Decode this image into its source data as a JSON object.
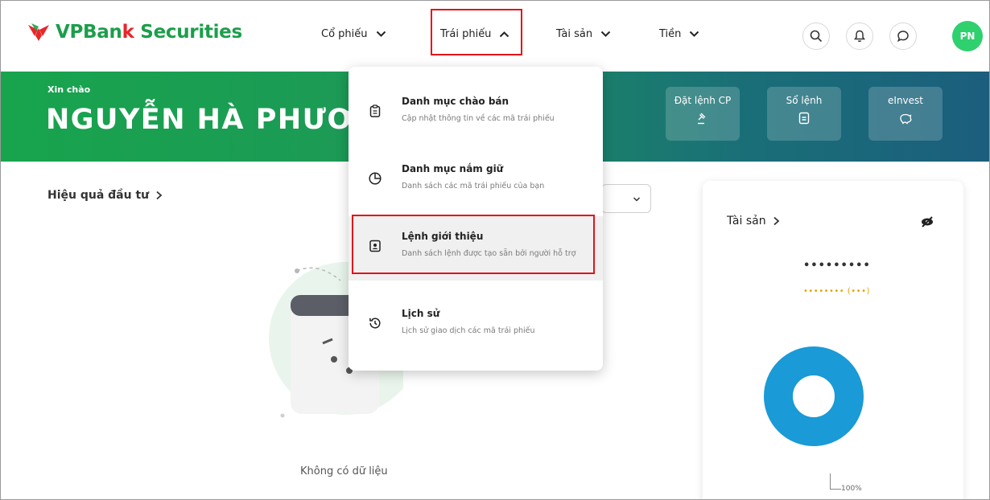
{
  "brand": {
    "name_part1": "VPBan",
    "name_accent": "k",
    "name_part2": " Securities"
  },
  "nav": {
    "items": [
      {
        "label": "Cổ phiếu"
      },
      {
        "label": "Trái phiếu"
      },
      {
        "label": "Tài sản"
      },
      {
        "label": "Tiền"
      }
    ]
  },
  "header_icons": [
    "search-icon",
    "bell-icon",
    "chat-icon"
  ],
  "avatar": {
    "initials": "PN"
  },
  "banner": {
    "greeting": "Xin chào",
    "username": "NGUYỄN HÀ PHƯƠN",
    "quick_actions": [
      {
        "label": "Đặt lệnh CP",
        "icon": "gavel-icon"
      },
      {
        "label": "Sổ lệnh",
        "icon": "document-icon"
      },
      {
        "label": "eInvest",
        "icon": "piggy-bank-icon"
      }
    ]
  },
  "performance": {
    "title": "Hiệu quả đầu tư",
    "empty_text": "Không có dữ liệu"
  },
  "assets": {
    "title": "Tài sản",
    "masked_value": "•••••••••",
    "masked_change": "•••••••• (•••)",
    "pie_label": "100%"
  },
  "dropdown": {
    "items": [
      {
        "title": "Danh mục chào bán",
        "desc": "Cập nhật thông tin về các mã trái phiếu",
        "icon": "clipboard-icon"
      },
      {
        "title": "Danh mục nắm giữ",
        "desc": "Danh sách các mã trái phiếu của bạn",
        "icon": "pie-chart-icon"
      },
      {
        "title": "Lệnh giới thiệu",
        "desc": "Danh sách lệnh được tạo sẵn bởi người hỗ trợ",
        "icon": "contact-card-icon"
      },
      {
        "title": "Lịch sử",
        "desc": "Lịch sử giao dịch các mã trái phiếu",
        "icon": "history-icon"
      }
    ]
  },
  "colors": {
    "brand_green": "#1c9e4b",
    "brand_red": "#e8262a",
    "highlight": "#e3121b",
    "donut": "#1a9ad6"
  }
}
